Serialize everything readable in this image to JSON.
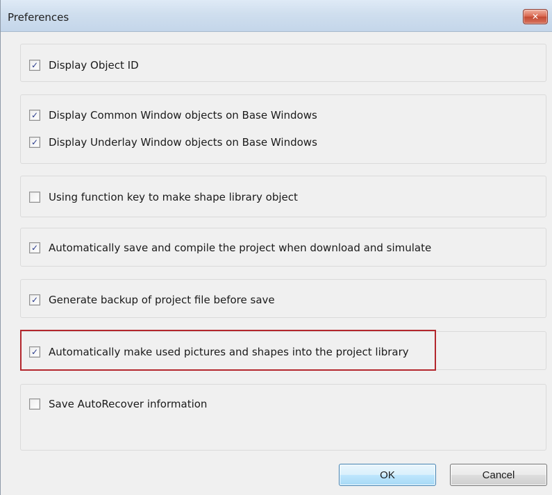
{
  "window": {
    "title": "Preferences",
    "close_glyph": "✕"
  },
  "check_glyph": "✓",
  "groups": [
    {
      "options": [
        {
          "label": "Display Object ID",
          "checked": true
        }
      ]
    },
    {
      "options": [
        {
          "label": "Display Common Window objects on Base Windows",
          "checked": true
        },
        {
          "label": "Display Underlay Window objects on Base Windows",
          "checked": true
        }
      ]
    },
    {
      "options": [
        {
          "label": "Using function key to make shape library object",
          "checked": false
        }
      ]
    },
    {
      "options": [
        {
          "label": "Automatically save and compile the project when download and simulate",
          "checked": true
        }
      ]
    },
    {
      "options": [
        {
          "label": "Generate backup of project file before save",
          "checked": true
        }
      ]
    },
    {
      "options": [
        {
          "label": "Automatically make used pictures and shapes into the project library",
          "checked": true
        }
      ]
    },
    {
      "options": [
        {
          "label": "Save AutoRecover information",
          "checked": false
        }
      ]
    }
  ],
  "buttons": {
    "ok_label": "OK",
    "cancel_label": "Cancel"
  },
  "colors": {
    "highlight": "#b3262c",
    "check": "#2a3b8c"
  }
}
